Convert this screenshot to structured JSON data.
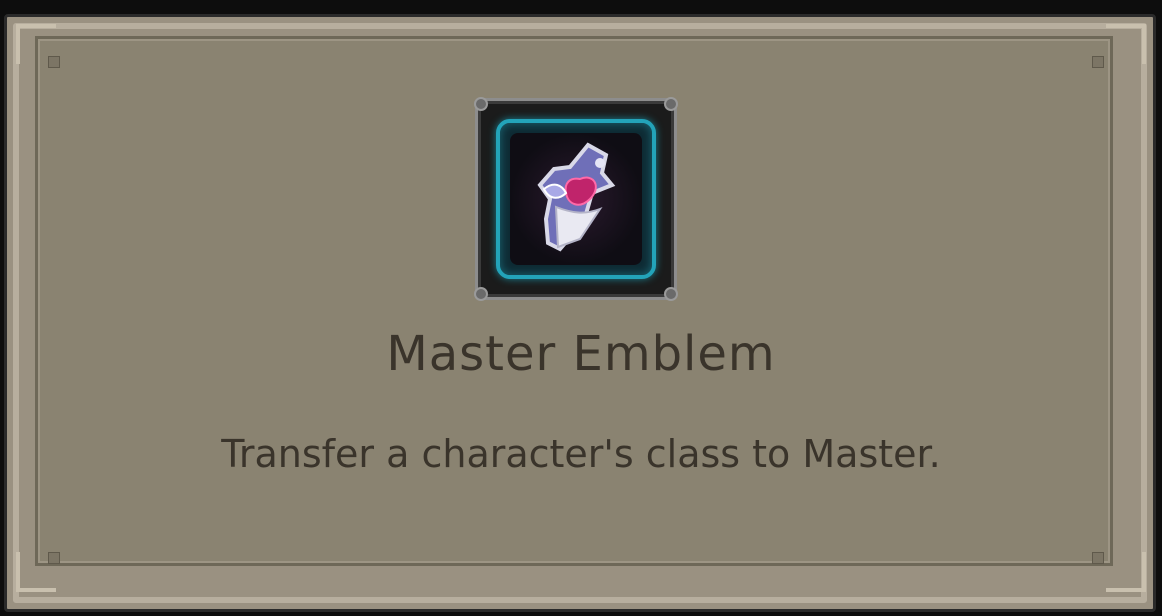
{
  "item": {
    "name": "Master Emblem",
    "description": "Transfer a character's class to Master.",
    "icon": "master-emblem-icon"
  },
  "colors": {
    "panel_background": "#8a8371",
    "frame_light": "#b7ae9e",
    "icon_border_glow": "#23a3b9",
    "text": "#3a342b"
  }
}
